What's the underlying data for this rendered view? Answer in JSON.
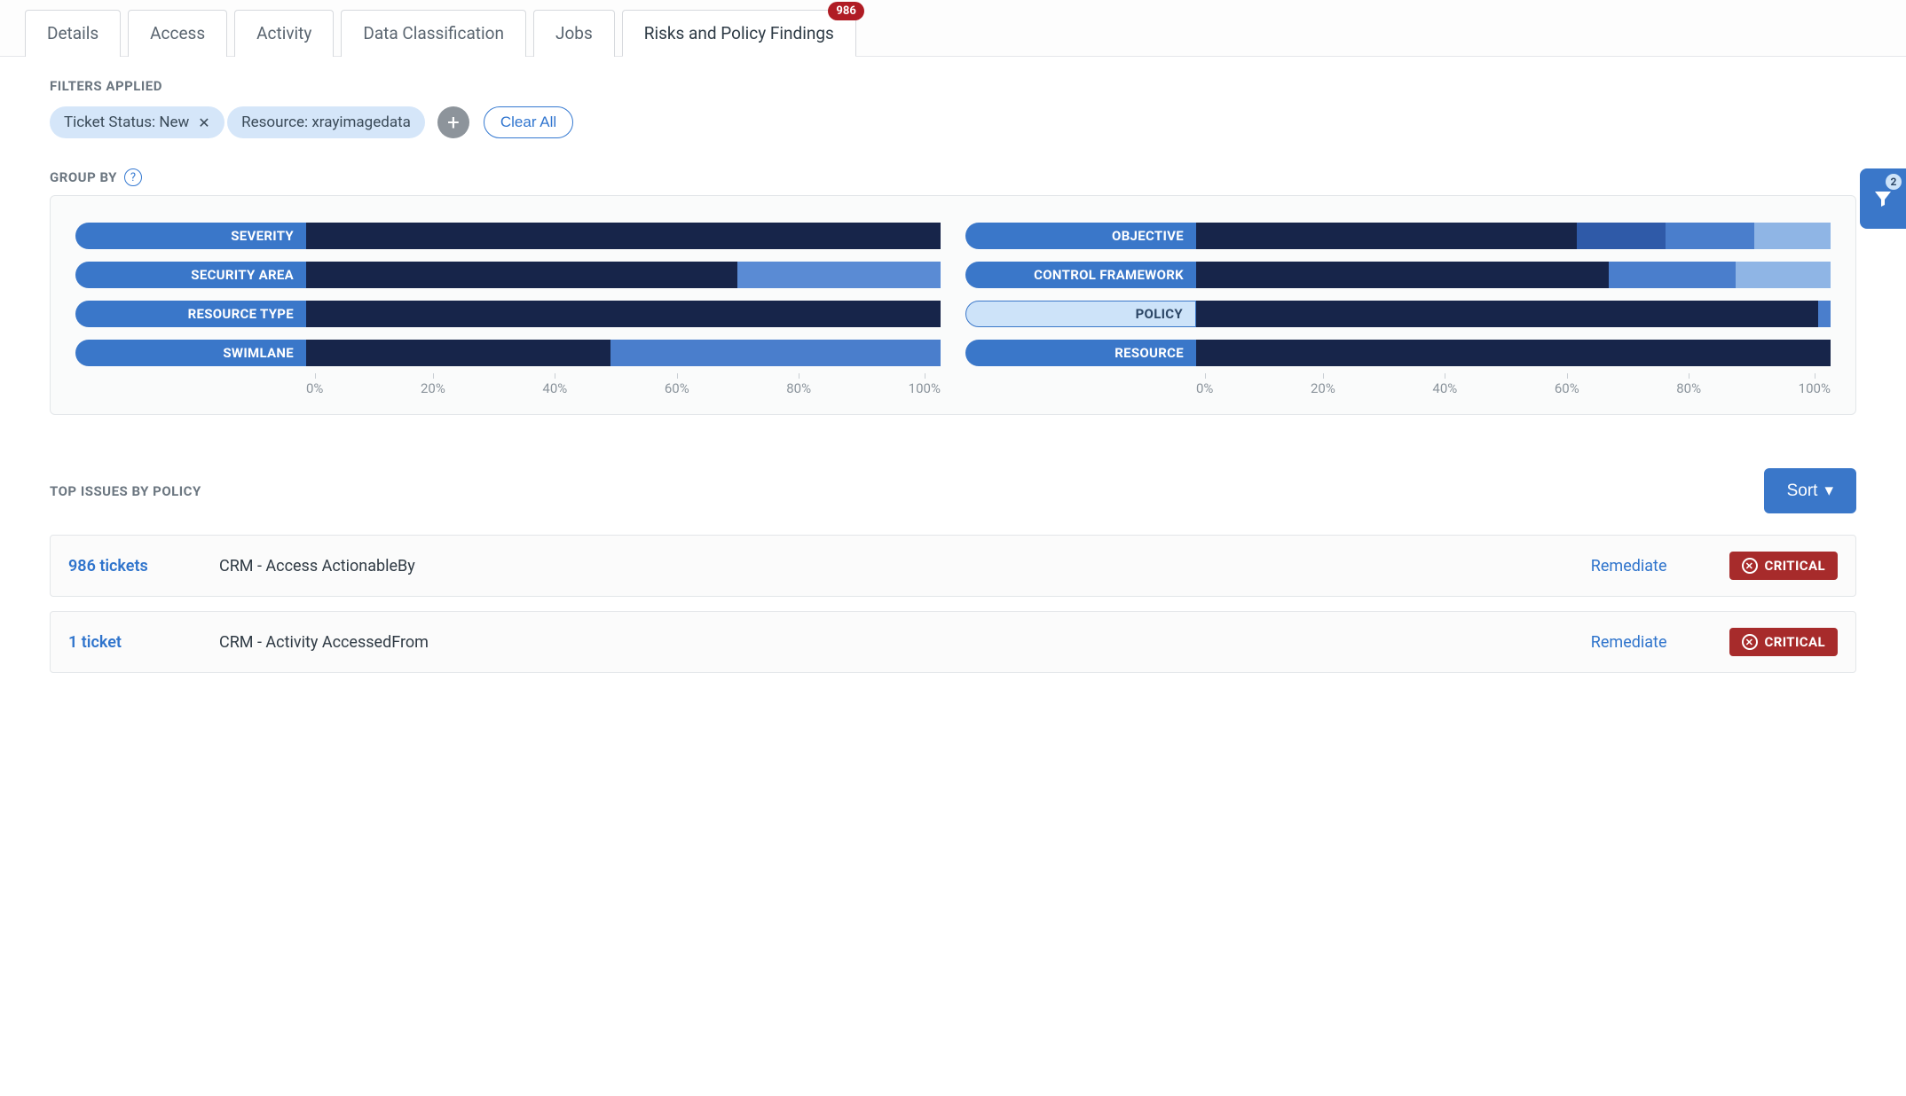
{
  "tabs": [
    {
      "label": "Details"
    },
    {
      "label": "Access"
    },
    {
      "label": "Activity"
    },
    {
      "label": "Data Classification"
    },
    {
      "label": "Jobs"
    },
    {
      "label": "Risks and Policy Findings",
      "badge": "986",
      "active": true
    }
  ],
  "filters": {
    "label": "FILTERS APPLIED",
    "chips": [
      {
        "text": "Ticket Status: New",
        "removable": true
      },
      {
        "text": "Resource: xrayimagedata",
        "removable": false
      }
    ],
    "clear_label": "Clear All",
    "fab_count": "2"
  },
  "groupby": {
    "label": "GROUP BY",
    "axis_ticks": [
      "0%",
      "20%",
      "40%",
      "60%",
      "80%",
      "100%"
    ],
    "left": [
      {
        "name": "SEVERITY",
        "segments": [
          {
            "w": 100,
            "c": "#17254a"
          }
        ]
      },
      {
        "name": "SECURITY AREA",
        "segments": [
          {
            "w": 68,
            "c": "#17254a"
          },
          {
            "w": 32,
            "c": "#5a8bd4"
          }
        ]
      },
      {
        "name": "RESOURCE TYPE",
        "segments": [
          {
            "w": 100,
            "c": "#17254a"
          }
        ]
      },
      {
        "name": "SWIMLANE",
        "segments": [
          {
            "w": 48,
            "c": "#17254a"
          },
          {
            "w": 52,
            "c": "#4a7ecc"
          }
        ]
      }
    ],
    "right": [
      {
        "name": "OBJECTIVE",
        "segments": [
          {
            "w": 60,
            "c": "#17254a"
          },
          {
            "w": 14,
            "c": "#2f5aa8"
          },
          {
            "w": 14,
            "c": "#4a7ecc"
          },
          {
            "w": 12,
            "c": "#8fb5e5"
          }
        ]
      },
      {
        "name": "CONTROL FRAMEWORK",
        "segments": [
          {
            "w": 65,
            "c": "#17254a"
          },
          {
            "w": 20,
            "c": "#4a7ecc"
          },
          {
            "w": 15,
            "c": "#8fb5e5"
          }
        ]
      },
      {
        "name": "POLICY",
        "selected": true,
        "segments": [
          {
            "w": 98,
            "c": "#17254a"
          },
          {
            "w": 2,
            "c": "#4a7ecc"
          }
        ]
      },
      {
        "name": "RESOURCE",
        "segments": [
          {
            "w": 100,
            "c": "#17254a"
          }
        ]
      }
    ]
  },
  "topissues": {
    "label": "TOP ISSUES BY POLICY",
    "sort_label": "Sort",
    "rows": [
      {
        "tickets": "986 tickets",
        "name": "CRM - Access ActionableBy",
        "remediate": "Remediate",
        "severity": "CRITICAL"
      },
      {
        "tickets": "1 ticket",
        "name": "CRM - Activity AccessedFrom",
        "remediate": "Remediate",
        "severity": "CRITICAL"
      }
    ]
  },
  "chart_data": {
    "type": "bar",
    "title": "Group By distribution",
    "xlabel": "percent",
    "xlim": [
      0,
      100
    ],
    "series": [
      {
        "name": "SEVERITY",
        "values": [
          100
        ]
      },
      {
        "name": "SECURITY AREA",
        "values": [
          68,
          32
        ]
      },
      {
        "name": "RESOURCE TYPE",
        "values": [
          100
        ]
      },
      {
        "name": "SWIMLANE",
        "values": [
          48,
          52
        ]
      },
      {
        "name": "OBJECTIVE",
        "values": [
          60,
          14,
          14,
          12
        ]
      },
      {
        "name": "CONTROL FRAMEWORK",
        "values": [
          65,
          20,
          15
        ]
      },
      {
        "name": "POLICY",
        "values": [
          98,
          2
        ]
      },
      {
        "name": "RESOURCE",
        "values": [
          100
        ]
      }
    ]
  }
}
